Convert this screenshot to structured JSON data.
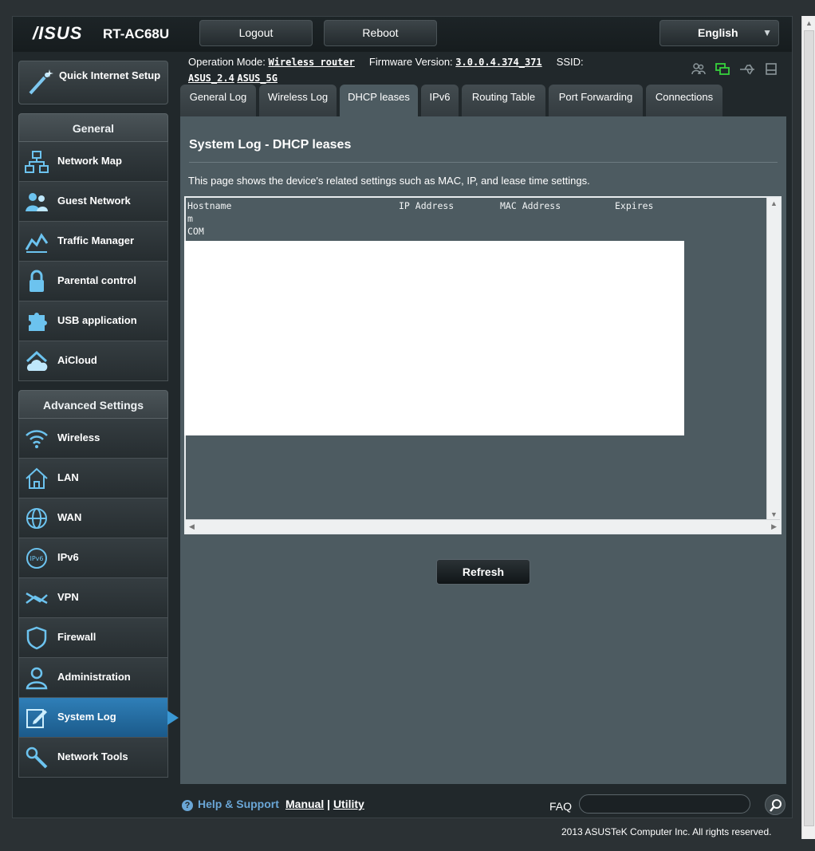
{
  "header": {
    "brand": "/ISUS",
    "model": "RT-AC68U",
    "logout_label": "Logout",
    "reboot_label": "Reboot",
    "language": "English"
  },
  "info": {
    "op_mode_label": "Operation Mode:",
    "op_mode_value": "Wireless router",
    "firmware_label": "Firmware Version:",
    "firmware_value": "3.0.0.4.374_371",
    "ssid_label": "SSID:",
    "ssid_1": "ASUS_2.4",
    "ssid_2": "ASUS_5G"
  },
  "quick_setup": {
    "label": "Quick Internet Setup"
  },
  "sidebar": {
    "general_title": "General",
    "general_items": [
      {
        "label": "Network Map",
        "icon": "network-map-icon"
      },
      {
        "label": "Guest Network",
        "icon": "guest-network-icon"
      },
      {
        "label": "Traffic Manager",
        "icon": "traffic-manager-icon"
      },
      {
        "label": "Parental control",
        "icon": "lock-icon"
      },
      {
        "label": "USB application",
        "icon": "puzzle-icon"
      },
      {
        "label": "AiCloud",
        "icon": "cloud-home-icon"
      }
    ],
    "advanced_title": "Advanced Settings",
    "advanced_items": [
      {
        "label": "Wireless",
        "icon": "wifi-icon"
      },
      {
        "label": "LAN",
        "icon": "home-icon"
      },
      {
        "label": "WAN",
        "icon": "globe-icon"
      },
      {
        "label": "IPv6",
        "icon": "ipv6-icon"
      },
      {
        "label": "VPN",
        "icon": "vpn-icon"
      },
      {
        "label": "Firewall",
        "icon": "shield-icon"
      },
      {
        "label": "Administration",
        "icon": "user-icon"
      },
      {
        "label": "System Log",
        "icon": "edit-log-icon",
        "active": true
      },
      {
        "label": "Network Tools",
        "icon": "tools-icon"
      }
    ]
  },
  "tabs": [
    {
      "label": "General Log"
    },
    {
      "label": "Wireless Log"
    },
    {
      "label": "DHCP leases",
      "active": true
    },
    {
      "label": "IPv6"
    },
    {
      "label": "Routing Table"
    },
    {
      "label": "Port Forwarding"
    },
    {
      "label": "Connections"
    }
  ],
  "main": {
    "title": "System Log - DHCP leases",
    "description": "This page shows the device's related settings such as MAC, IP, and lease time settings.",
    "columns": [
      "Hostname",
      "IP Address",
      "MAC Address",
      "Expires"
    ],
    "rows": [
      "m",
      "COM"
    ],
    "refresh_label": "Refresh"
  },
  "footer": {
    "help_label": "Help & Support",
    "manual_label": "Manual",
    "separator": "|",
    "utility_label": "Utility",
    "faq_label": "FAQ",
    "copyright": "2013 ASUSTeK Computer Inc. All rights reserved."
  }
}
